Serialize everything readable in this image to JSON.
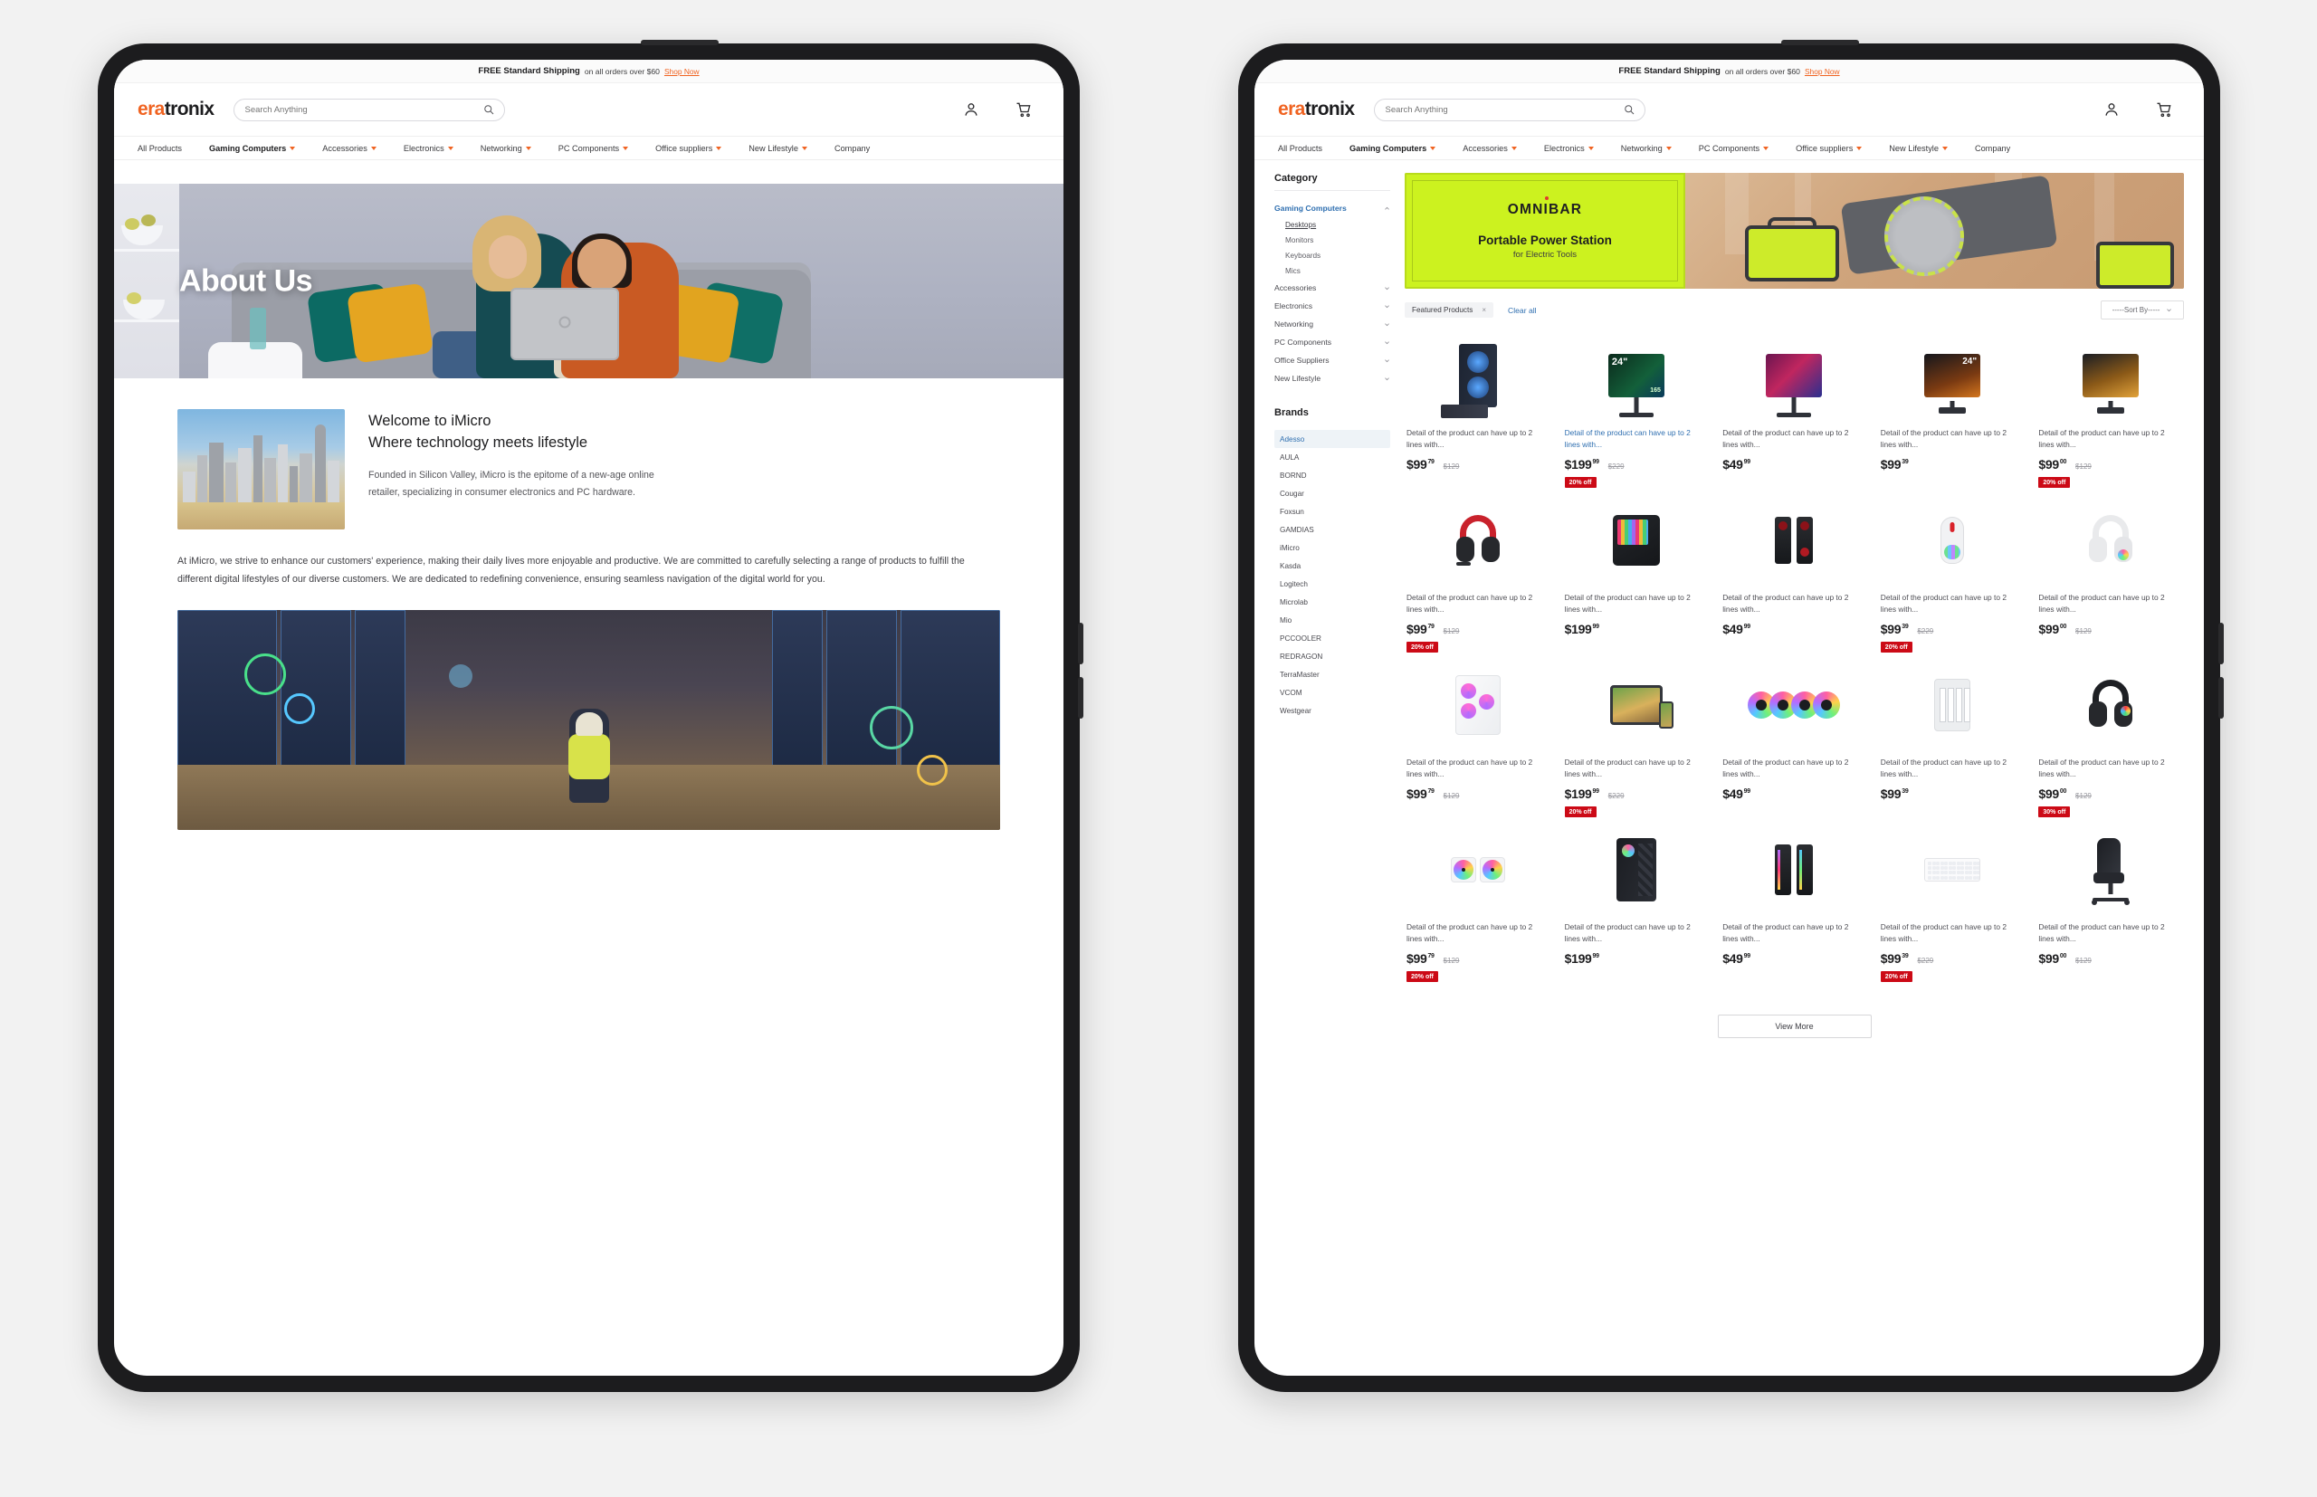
{
  "site": {
    "promo": {
      "bold": "FREE Standard Shipping",
      "rest": "on all orders over $60",
      "link": "Shop Now"
    },
    "logo": {
      "part_a": "era",
      "part_b": "tronix"
    },
    "search": {
      "placeholder": "Search Anything",
      "value": "",
      "icon": "search-icon"
    },
    "header_icons": [
      {
        "name": "account-icon",
        "label": "Account"
      },
      {
        "name": "cart-icon",
        "label": "Cart"
      }
    ],
    "nav": [
      {
        "label": "All Products",
        "caret": false,
        "active": false
      },
      {
        "label": "Gaming Computers",
        "caret": true,
        "active": true
      },
      {
        "label": "Accessories",
        "caret": true,
        "active": false
      },
      {
        "label": "Electronics",
        "caret": true,
        "active": false
      },
      {
        "label": "Networking",
        "caret": true,
        "active": false
      },
      {
        "label": "PC Components",
        "caret": true,
        "active": false
      },
      {
        "label": "Office suppliers",
        "caret": true,
        "active": false
      },
      {
        "label": "New Lifestyle",
        "caret": true,
        "active": false
      },
      {
        "label": "Company",
        "caret": false,
        "active": false
      }
    ]
  },
  "about_page": {
    "hero_title": "About Us",
    "heading_line1": "Welcome to iMicro",
    "heading_line2": "Where technology meets lifestyle",
    "intro_paragraph": "Founded in Silicon Valley, iMicro is the epitome of a new-age online retailer, specializing in consumer electronics and PC hardware.",
    "body_paragraph": "At iMicro, we strive to enhance our customers' experience, making their daily lives more enjoyable and productive. We are committed to carefully selecting a range of products to fulfill the different digital lifestyles of our diverse customers. We are dedicated to redefining convenience, ensuring seamless navigation of the digital world for you.",
    "image_city_alt": "san-francisco-skyline",
    "image_warehouse_alt": "smart-warehouse-worker"
  },
  "category_page": {
    "sidebar": {
      "category_heading": "Category",
      "categories": [
        {
          "label": "Gaming Computers",
          "expanded": true,
          "active": true,
          "children": [
            {
              "label": "Desktops",
              "selected": true
            },
            {
              "label": "Monitors",
              "selected": false
            },
            {
              "label": "Keyboards",
              "selected": false
            },
            {
              "label": "Mics",
              "selected": false
            }
          ]
        },
        {
          "label": "Accessories",
          "expanded": false,
          "active": false,
          "children": []
        },
        {
          "label": "Electronics",
          "expanded": false,
          "active": false,
          "children": []
        },
        {
          "label": "Networking",
          "expanded": false,
          "active": false,
          "children": []
        },
        {
          "label": "PC Components",
          "expanded": false,
          "active": false,
          "children": []
        },
        {
          "label": "Office Suppliers",
          "expanded": false,
          "active": false,
          "children": []
        },
        {
          "label": "New Lifestyle",
          "expanded": false,
          "active": false,
          "children": []
        }
      ],
      "brands_heading": "Brands",
      "brands": [
        {
          "label": "Adesso",
          "active": true
        },
        {
          "label": "AULA",
          "active": false
        },
        {
          "label": "BORND",
          "active": false
        },
        {
          "label": "Cougar",
          "active": false
        },
        {
          "label": "Foxsun",
          "active": false
        },
        {
          "label": "GAMDIAS",
          "active": false
        },
        {
          "label": "iMicro",
          "active": false
        },
        {
          "label": "Kasda",
          "active": false
        },
        {
          "label": "Logitech",
          "active": false
        },
        {
          "label": "Microlab",
          "active": false
        },
        {
          "label": "Mio",
          "active": false
        },
        {
          "label": "PCCOOLER",
          "active": false
        },
        {
          "label": "REDRAGON",
          "active": false
        },
        {
          "label": "TerraMaster",
          "active": false
        },
        {
          "label": "VCOM",
          "active": false
        },
        {
          "label": "Westgear",
          "active": false
        }
      ]
    },
    "banner": {
      "brand": "OMNIBAR",
      "title": "Portable Power Station",
      "subtitle": "for Electric Tools",
      "bg_color": "#ccf21f"
    },
    "filters": {
      "chip_label": "Featured Products",
      "chip_close": "×",
      "clear_all": "Clear all",
      "sort_label": "-----Sort By-----"
    },
    "products": [
      {
        "art": "tower-pc",
        "desc": "Detail of the product can have up to 2 lines with...",
        "price": "$99",
        "cents": "79",
        "old": "$129",
        "badge": "",
        "linked": false
      },
      {
        "art": "monitor-green",
        "desc": "Detail of the product can have up to 2 lines with...",
        "price": "$199",
        "cents": "99",
        "old": "$229",
        "badge": "20% off",
        "linked": true
      },
      {
        "art": "monitor-pink",
        "desc": "Detail of the product can have up to 2 lines with...",
        "price": "$49",
        "cents": "99",
        "old": "",
        "badge": "",
        "linked": false
      },
      {
        "art": "monitor-hdr",
        "desc": "Detail of the product can have up to 2 lines with...",
        "price": "$99",
        "cents": "39",
        "old": "",
        "badge": "",
        "linked": false
      },
      {
        "art": "monitor-fhd",
        "desc": "Detail of the product can have up to 2 lines with...",
        "price": "$99",
        "cents": "00",
        "old": "$129",
        "badge": "20% off",
        "linked": false
      },
      {
        "art": "headset-red",
        "desc": "Detail of the product can have up to 2 lines with...",
        "price": "$99",
        "cents": "79",
        "old": "$129",
        "badge": "20% off",
        "linked": false
      },
      {
        "art": "keypad-rgb",
        "desc": "Detail of the product can have up to 2 lines with...",
        "price": "$199",
        "cents": "99",
        "old": "",
        "badge": "",
        "linked": false
      },
      {
        "art": "speakers-red",
        "desc": "Detail of the product can have up to 2 lines with...",
        "price": "$49",
        "cents": "99",
        "old": "",
        "badge": "",
        "linked": false
      },
      {
        "art": "mouse-white",
        "desc": "Detail of the product can have up to 2 lines with...",
        "price": "$99",
        "cents": "39",
        "old": "$229",
        "badge": "20% off",
        "linked": false
      },
      {
        "art": "headset-white",
        "desc": "Detail of the product can have up to 2 lines with...",
        "price": "$99",
        "cents": "00",
        "old": "$129",
        "badge": "",
        "linked": false
      },
      {
        "art": "case-white",
        "desc": "Detail of the product can have up to 2 lines with...",
        "price": "$99",
        "cents": "79",
        "old": "$129",
        "badge": "",
        "linked": false
      },
      {
        "art": "tablet-phone",
        "desc": "Detail of the product can have up to 2 lines with...",
        "price": "$199",
        "cents": "99",
        "old": "$229",
        "badge": "20% off",
        "linked": false
      },
      {
        "art": "fans-rgb",
        "desc": "Detail of the product can have up to 2 lines with...",
        "price": "$49",
        "cents": "99",
        "old": "",
        "badge": "",
        "linked": false
      },
      {
        "art": "nas-white",
        "desc": "Detail of the product can have up to 2 lines with...",
        "price": "$99",
        "cents": "39",
        "old": "",
        "badge": "",
        "linked": false
      },
      {
        "art": "headset-black",
        "desc": "Detail of the product can have up to 2 lines with...",
        "price": "$99",
        "cents": "00",
        "old": "$129",
        "badge": "30% off",
        "linked": false
      },
      {
        "art": "aio-cooler",
        "desc": "Detail of the product can have up to 2 lines with...",
        "price": "$99",
        "cents": "79",
        "old": "$129",
        "badge": "20% off",
        "linked": false
      },
      {
        "art": "case-black",
        "desc": "Detail of the product can have up to 2 lines with...",
        "price": "$199",
        "cents": "99",
        "old": "",
        "badge": "",
        "linked": false
      },
      {
        "art": "speakers-rgb",
        "desc": "Detail of the product can have up to 2 lines with...",
        "price": "$49",
        "cents": "99",
        "old": "",
        "badge": "",
        "linked": false
      },
      {
        "art": "keyboard-white",
        "desc": "Detail of the product can have up to 2 lines with...",
        "price": "$99",
        "cents": "39",
        "old": "$229",
        "badge": "20% off",
        "linked": false
      },
      {
        "art": "gaming-chair",
        "desc": "Detail of the product can have up to 2 lines with...",
        "price": "$99",
        "cents": "00",
        "old": "$129",
        "badge": "",
        "linked": false
      }
    ],
    "view_more": "View More"
  },
  "colors": {
    "brand_orange": "#f06321",
    "link_blue": "#2f6fb0",
    "badge_red": "#cc0a16",
    "banner_green": "#ccf21f",
    "page_bg": "#f2f2f2"
  }
}
